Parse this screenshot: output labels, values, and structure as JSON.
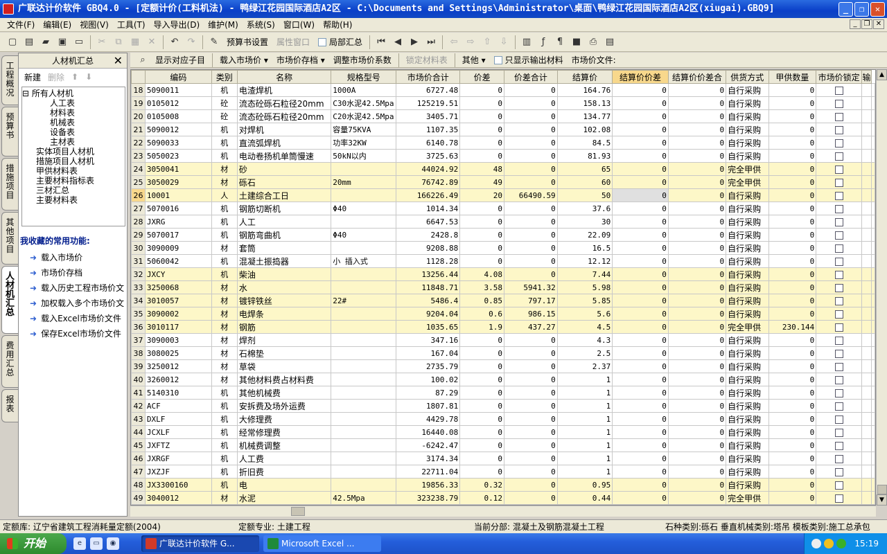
{
  "window": {
    "title": "广联达计价软件 GBQ4.0 - [定额计价(工料机法) - 鸭绿江花园国际酒店A2区 - C:\\Documents and Settings\\Administrator\\桌面\\鸭绿江花园国际酒店A2区(xiugai).GBQ9]"
  },
  "menu": [
    "文件(F)",
    "编辑(E)",
    "视图(V)",
    "工具(T)",
    "导入导出(D)",
    "维护(M)",
    "系统(S)",
    "窗口(W)",
    "帮助(H)"
  ],
  "toolbar": {
    "budget_settings": "预算书设置",
    "properties_window": "属性窗口",
    "local_summary": "局部汇总"
  },
  "vtabs": [
    "工程概况",
    "预算书",
    "措施项目",
    "其他项目",
    "人材机汇总",
    "费用汇总",
    "报表"
  ],
  "leftpanel": {
    "title": "人材机汇总",
    "new": "新建",
    "delete": "删除",
    "tree": {
      "root": "所有人材机",
      "children": [
        "人工表",
        "材料表",
        "机械表",
        "设备表",
        "主材表"
      ],
      "others": [
        "实体项目人材机",
        "措施项目人材机",
        "甲供材料表",
        "主要材料指标表",
        "三材汇总",
        "主要材料表"
      ]
    },
    "fav_title": "我收藏的常用功能:",
    "favorites": [
      "载入市场价",
      "市场价存档",
      "载入历史工程市场价文",
      "加权载入多个市场价文",
      "载入Excel市场价文件",
      "保存Excel市场价文件"
    ]
  },
  "gridtoolbar": {
    "show_sub": "显示对应子目",
    "load_price": "载入市场价",
    "save_price": "市场价存档",
    "adjust_price": "调整市场价系数",
    "lock_qty": "锁定材料表",
    "other": "其他",
    "only_output": "只显示输出材料",
    "price_file": "市场价文件:"
  },
  "grid": {
    "columns": [
      "编码",
      "类别",
      "名称",
      "规格型号",
      "市场价合计",
      "价差",
      "价差合计",
      "结算价",
      "结算价价差",
      "结算价价差合",
      "供货方式",
      "甲供数量",
      "市场价锁定",
      "输"
    ],
    "rows": [
      {
        "n": "18",
        "code": "5090011",
        "cat": "机",
        "name": "电渣焊机",
        "spec": "1000A",
        "total": "6727.48",
        "diff": "0",
        "difftotal": "0",
        "settle": "164.76",
        "sd": "0",
        "sdt": "0",
        "supply": "自行采购",
        "qty": "0"
      },
      {
        "n": "19",
        "code": "0105012",
        "cat": "砼",
        "name": "流态砼砾石粒径20mm",
        "spec": "C30水泥42.5Mpa",
        "total": "125219.51",
        "diff": "0",
        "difftotal": "0",
        "settle": "158.13",
        "sd": "0",
        "sdt": "0",
        "supply": "自行采购",
        "qty": "0"
      },
      {
        "n": "20",
        "code": "0105008",
        "cat": "砼",
        "name": "流态砼砾石粒径20mm",
        "spec": "C20水泥42.5Mpa",
        "total": "3405.71",
        "diff": "0",
        "difftotal": "0",
        "settle": "134.77",
        "sd": "0",
        "sdt": "0",
        "supply": "自行采购",
        "qty": "0"
      },
      {
        "n": "21",
        "code": "5090012",
        "cat": "机",
        "name": "对焊机",
        "spec": "容量75KVA",
        "total": "1107.35",
        "diff": "0",
        "difftotal": "0",
        "settle": "102.08",
        "sd": "0",
        "sdt": "0",
        "supply": "自行采购",
        "qty": "0"
      },
      {
        "n": "22",
        "code": "5090033",
        "cat": "机",
        "name": "直流弧焊机",
        "spec": "功率32KW",
        "total": "6140.78",
        "diff": "0",
        "difftotal": "0",
        "settle": "84.5",
        "sd": "0",
        "sdt": "0",
        "supply": "自行采购",
        "qty": "0"
      },
      {
        "n": "23",
        "code": "5050023",
        "cat": "机",
        "name": "电动卷扬机单筒慢速",
        "spec": "50kN以内",
        "total": "3725.63",
        "diff": "0",
        "difftotal": "0",
        "settle": "81.93",
        "sd": "0",
        "sdt": "0",
        "supply": "自行采购",
        "qty": "0"
      },
      {
        "n": "24",
        "code": "3050041",
        "cat": "材",
        "name": "砂",
        "spec": "",
        "total": "44024.92",
        "diff": "48",
        "difftotal": "0",
        "settle": "65",
        "sd": "0",
        "sdt": "0",
        "supply": "完全甲供",
        "qty": "0",
        "y": true
      },
      {
        "n": "25",
        "code": "3050029",
        "cat": "材",
        "name": "砾石",
        "spec": "20mm",
        "total": "76742.89",
        "diff": "49",
        "difftotal": "0",
        "settle": "60",
        "sd": "0",
        "sdt": "0",
        "supply": "完全甲供",
        "qty": "0",
        "y": true
      },
      {
        "n": "26",
        "code": "10001",
        "cat": "人",
        "name": "土建综合工日",
        "spec": "",
        "total": "166226.49",
        "diff": "20",
        "difftotal": "66490.59",
        "settle": "50",
        "sd": "0",
        "sdt": "0",
        "supply": "自行采购",
        "qty": "0",
        "y": true,
        "sel": true
      },
      {
        "n": "27",
        "code": "5070016",
        "cat": "机",
        "name": "钢筋切断机",
        "spec": "Φ40",
        "total": "1014.34",
        "diff": "0",
        "difftotal": "0",
        "settle": "37.6",
        "sd": "0",
        "sdt": "0",
        "supply": "自行采购",
        "qty": "0"
      },
      {
        "n": "28",
        "code": "JXRG",
        "cat": "机",
        "name": "人工",
        "spec": "",
        "total": "6647.53",
        "diff": "0",
        "difftotal": "0",
        "settle": "30",
        "sd": "0",
        "sdt": "0",
        "supply": "自行采购",
        "qty": "0"
      },
      {
        "n": "29",
        "code": "5070017",
        "cat": "机",
        "name": "钢筋弯曲机",
        "spec": "Φ40",
        "total": "2428.8",
        "diff": "0",
        "difftotal": "0",
        "settle": "22.09",
        "sd": "0",
        "sdt": "0",
        "supply": "自行采购",
        "qty": "0"
      },
      {
        "n": "30",
        "code": "3090009",
        "cat": "材",
        "name": "套筒",
        "spec": "",
        "total": "9208.88",
        "diff": "0",
        "difftotal": "0",
        "settle": "16.5",
        "sd": "0",
        "sdt": "0",
        "supply": "自行采购",
        "qty": "0"
      },
      {
        "n": "31",
        "code": "5060042",
        "cat": "机",
        "name": "混凝土振捣器",
        "spec": "小 插入式",
        "total": "1128.28",
        "diff": "0",
        "difftotal": "0",
        "settle": "12.12",
        "sd": "0",
        "sdt": "0",
        "supply": "自行采购",
        "qty": "0"
      },
      {
        "n": "32",
        "code": "JXCY",
        "cat": "机",
        "name": "柴油",
        "spec": "",
        "total": "13256.44",
        "diff": "4.08",
        "difftotal": "0",
        "settle": "7.44",
        "sd": "0",
        "sdt": "0",
        "supply": "自行采购",
        "qty": "0",
        "y": true
      },
      {
        "n": "33",
        "code": "3250068",
        "cat": "材",
        "name": "水",
        "spec": "",
        "total": "11848.71",
        "diff": "3.58",
        "difftotal": "5941.32",
        "settle": "5.98",
        "sd": "0",
        "sdt": "0",
        "supply": "自行采购",
        "qty": "0",
        "y": true
      },
      {
        "n": "34",
        "code": "3010057",
        "cat": "材",
        "name": "镀锌铁丝",
        "spec": "22#",
        "total": "5486.4",
        "diff": "0.85",
        "difftotal": "797.17",
        "settle": "5.85",
        "sd": "0",
        "sdt": "0",
        "supply": "自行采购",
        "qty": "0",
        "y": true
      },
      {
        "n": "35",
        "code": "3090002",
        "cat": "材",
        "name": "电焊条",
        "spec": "",
        "total": "9204.04",
        "diff": "0.6",
        "difftotal": "986.15",
        "settle": "5.6",
        "sd": "0",
        "sdt": "0",
        "supply": "自行采购",
        "qty": "0",
        "y": true
      },
      {
        "n": "36",
        "code": "3010117",
        "cat": "材",
        "name": "钢筋",
        "spec": "",
        "total": "1035.65",
        "diff": "1.9",
        "difftotal": "437.27",
        "settle": "4.5",
        "sd": "0",
        "sdt": "0",
        "supply": "完全甲供",
        "qty": "230.144",
        "y": true
      },
      {
        "n": "37",
        "code": "3090003",
        "cat": "材",
        "name": "焊剂",
        "spec": "",
        "total": "347.16",
        "diff": "0",
        "difftotal": "0",
        "settle": "4.3",
        "sd": "0",
        "sdt": "0",
        "supply": "自行采购",
        "qty": "0"
      },
      {
        "n": "38",
        "code": "3080025",
        "cat": "材",
        "name": "石棉垫",
        "spec": "",
        "total": "167.04",
        "diff": "0",
        "difftotal": "0",
        "settle": "2.5",
        "sd": "0",
        "sdt": "0",
        "supply": "自行采购",
        "qty": "0"
      },
      {
        "n": "39",
        "code": "3250012",
        "cat": "材",
        "name": "草袋",
        "spec": "",
        "total": "2735.79",
        "diff": "0",
        "difftotal": "0",
        "settle": "2.37",
        "sd": "0",
        "sdt": "0",
        "supply": "自行采购",
        "qty": "0"
      },
      {
        "n": "40",
        "code": "3260012",
        "cat": "材",
        "name": "其他材料费占材料费",
        "spec": "",
        "total": "100.02",
        "diff": "0",
        "difftotal": "0",
        "settle": "1",
        "sd": "0",
        "sdt": "0",
        "supply": "自行采购",
        "qty": "0"
      },
      {
        "n": "41",
        "code": "5140310",
        "cat": "机",
        "name": "其他机械费",
        "spec": "",
        "total": "87.29",
        "diff": "0",
        "difftotal": "0",
        "settle": "1",
        "sd": "0",
        "sdt": "0",
        "supply": "自行采购",
        "qty": "0"
      },
      {
        "n": "42",
        "code": "ACF",
        "cat": "机",
        "name": "安拆费及场外运费",
        "spec": "",
        "total": "1807.81",
        "diff": "0",
        "difftotal": "0",
        "settle": "1",
        "sd": "0",
        "sdt": "0",
        "supply": "自行采购",
        "qty": "0"
      },
      {
        "n": "43",
        "code": "DXLF",
        "cat": "机",
        "name": "大修理费",
        "spec": "",
        "total": "4429.78",
        "diff": "0",
        "difftotal": "0",
        "settle": "1",
        "sd": "0",
        "sdt": "0",
        "supply": "自行采购",
        "qty": "0"
      },
      {
        "n": "44",
        "code": "JCXLF",
        "cat": "机",
        "name": "经常修理费",
        "spec": "",
        "total": "16440.08",
        "diff": "0",
        "difftotal": "0",
        "settle": "1",
        "sd": "0",
        "sdt": "0",
        "supply": "自行采购",
        "qty": "0"
      },
      {
        "n": "45",
        "code": "JXFTZ",
        "cat": "机",
        "name": "机械费调整",
        "spec": "",
        "total": "-6242.47",
        "diff": "0",
        "difftotal": "0",
        "settle": "1",
        "sd": "0",
        "sdt": "0",
        "supply": "自行采购",
        "qty": "0"
      },
      {
        "n": "46",
        "code": "JXRGF",
        "cat": "机",
        "name": "人工费",
        "spec": "",
        "total": "3174.34",
        "diff": "0",
        "difftotal": "0",
        "settle": "1",
        "sd": "0",
        "sdt": "0",
        "supply": "自行采购",
        "qty": "0"
      },
      {
        "n": "47",
        "code": "JXZJF",
        "cat": "机",
        "name": "折旧费",
        "spec": "",
        "total": "22711.04",
        "diff": "0",
        "difftotal": "0",
        "settle": "1",
        "sd": "0",
        "sdt": "0",
        "supply": "自行采购",
        "qty": "0"
      },
      {
        "n": "48",
        "code": "JX3300160",
        "cat": "机",
        "name": "电",
        "spec": "",
        "total": "19856.33",
        "diff": "0.32",
        "difftotal": "0",
        "settle": "0.95",
        "sd": "0",
        "sdt": "0",
        "supply": "自行采购",
        "qty": "0",
        "y": true
      },
      {
        "n": "49",
        "code": "3040012",
        "cat": "材",
        "name": "水泥",
        "spec": "42.5Mpa",
        "total": "323238.79",
        "diff": "0.12",
        "difftotal": "0",
        "settle": "0.44",
        "sd": "0",
        "sdt": "0",
        "supply": "完全甲供",
        "qty": "0",
        "y": true
      }
    ]
  },
  "status": {
    "quota_lib": "定额库: 辽宁省建筑工程消耗量定额(2004)",
    "quota_major": "定额专业: 土建工程",
    "current_section": "当前分部: 混凝土及钢筋混凝土工程",
    "types": "石种类别:砾石  垂直机械类别:塔吊  模板类别:施工总承包"
  },
  "taskbar": {
    "start": "开始",
    "task1": "广联达计价软件 G...",
    "task2": "Microsoft Excel ...",
    "clock": "15:19"
  }
}
